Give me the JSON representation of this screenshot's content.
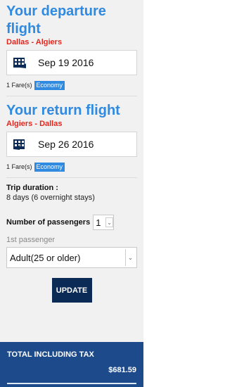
{
  "departure": {
    "title": "Your departure flight",
    "route": "Dallas - Algiers",
    "date": "Sep 19 2016",
    "fares": "1 Fare(s)",
    "class": "Economy"
  },
  "return": {
    "title": "Your return flight",
    "route": "Algiers - Dallas",
    "date": "Sep 26 2016",
    "fares": "1 Fare(s)",
    "class": "Economy"
  },
  "trip": {
    "label": "Trip duration :",
    "value": "8 days (6 overnight stays)"
  },
  "passengers": {
    "label": "Number of passengers",
    "selected": "1",
    "first_label": "1st passenger",
    "first_type": "Adult(25 or older)"
  },
  "actions": {
    "update_label": "UPDATE"
  },
  "total": {
    "label": "TOTAL INCLUDING TAX",
    "amount": "$681.59"
  },
  "colors": {
    "title_blue": "#2f8ae0",
    "route_red": "#e3261d",
    "panel_bg": "#f1f1f1",
    "button_navy": "#0b2a55",
    "total_blue": "#1d4a8a"
  },
  "icons": {
    "calendar": "calendar-icon",
    "dropdown": "chevron-down-icon"
  }
}
